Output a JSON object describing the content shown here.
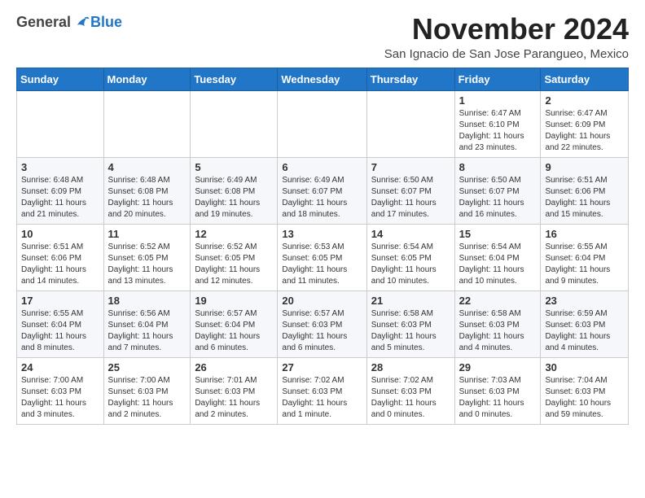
{
  "logo": {
    "general": "General",
    "blue": "Blue"
  },
  "header": {
    "month_title": "November 2024",
    "subtitle": "San Ignacio de San Jose Parangueo, Mexico"
  },
  "weekdays": [
    "Sunday",
    "Monday",
    "Tuesday",
    "Wednesday",
    "Thursday",
    "Friday",
    "Saturday"
  ],
  "weeks": [
    [
      {
        "day": "",
        "info": ""
      },
      {
        "day": "",
        "info": ""
      },
      {
        "day": "",
        "info": ""
      },
      {
        "day": "",
        "info": ""
      },
      {
        "day": "",
        "info": ""
      },
      {
        "day": "1",
        "info": "Sunrise: 6:47 AM\nSunset: 6:10 PM\nDaylight: 11 hours and 23 minutes."
      },
      {
        "day": "2",
        "info": "Sunrise: 6:47 AM\nSunset: 6:09 PM\nDaylight: 11 hours and 22 minutes."
      }
    ],
    [
      {
        "day": "3",
        "info": "Sunrise: 6:48 AM\nSunset: 6:09 PM\nDaylight: 11 hours and 21 minutes."
      },
      {
        "day": "4",
        "info": "Sunrise: 6:48 AM\nSunset: 6:08 PM\nDaylight: 11 hours and 20 minutes."
      },
      {
        "day": "5",
        "info": "Sunrise: 6:49 AM\nSunset: 6:08 PM\nDaylight: 11 hours and 19 minutes."
      },
      {
        "day": "6",
        "info": "Sunrise: 6:49 AM\nSunset: 6:07 PM\nDaylight: 11 hours and 18 minutes."
      },
      {
        "day": "7",
        "info": "Sunrise: 6:50 AM\nSunset: 6:07 PM\nDaylight: 11 hours and 17 minutes."
      },
      {
        "day": "8",
        "info": "Sunrise: 6:50 AM\nSunset: 6:07 PM\nDaylight: 11 hours and 16 minutes."
      },
      {
        "day": "9",
        "info": "Sunrise: 6:51 AM\nSunset: 6:06 PM\nDaylight: 11 hours and 15 minutes."
      }
    ],
    [
      {
        "day": "10",
        "info": "Sunrise: 6:51 AM\nSunset: 6:06 PM\nDaylight: 11 hours and 14 minutes."
      },
      {
        "day": "11",
        "info": "Sunrise: 6:52 AM\nSunset: 6:05 PM\nDaylight: 11 hours and 13 minutes."
      },
      {
        "day": "12",
        "info": "Sunrise: 6:52 AM\nSunset: 6:05 PM\nDaylight: 11 hours and 12 minutes."
      },
      {
        "day": "13",
        "info": "Sunrise: 6:53 AM\nSunset: 6:05 PM\nDaylight: 11 hours and 11 minutes."
      },
      {
        "day": "14",
        "info": "Sunrise: 6:54 AM\nSunset: 6:05 PM\nDaylight: 11 hours and 10 minutes."
      },
      {
        "day": "15",
        "info": "Sunrise: 6:54 AM\nSunset: 6:04 PM\nDaylight: 11 hours and 10 minutes."
      },
      {
        "day": "16",
        "info": "Sunrise: 6:55 AM\nSunset: 6:04 PM\nDaylight: 11 hours and 9 minutes."
      }
    ],
    [
      {
        "day": "17",
        "info": "Sunrise: 6:55 AM\nSunset: 6:04 PM\nDaylight: 11 hours and 8 minutes."
      },
      {
        "day": "18",
        "info": "Sunrise: 6:56 AM\nSunset: 6:04 PM\nDaylight: 11 hours and 7 minutes."
      },
      {
        "day": "19",
        "info": "Sunrise: 6:57 AM\nSunset: 6:04 PM\nDaylight: 11 hours and 6 minutes."
      },
      {
        "day": "20",
        "info": "Sunrise: 6:57 AM\nSunset: 6:03 PM\nDaylight: 11 hours and 6 minutes."
      },
      {
        "day": "21",
        "info": "Sunrise: 6:58 AM\nSunset: 6:03 PM\nDaylight: 11 hours and 5 minutes."
      },
      {
        "day": "22",
        "info": "Sunrise: 6:58 AM\nSunset: 6:03 PM\nDaylight: 11 hours and 4 minutes."
      },
      {
        "day": "23",
        "info": "Sunrise: 6:59 AM\nSunset: 6:03 PM\nDaylight: 11 hours and 4 minutes."
      }
    ],
    [
      {
        "day": "24",
        "info": "Sunrise: 7:00 AM\nSunset: 6:03 PM\nDaylight: 11 hours and 3 minutes."
      },
      {
        "day": "25",
        "info": "Sunrise: 7:00 AM\nSunset: 6:03 PM\nDaylight: 11 hours and 2 minutes."
      },
      {
        "day": "26",
        "info": "Sunrise: 7:01 AM\nSunset: 6:03 PM\nDaylight: 11 hours and 2 minutes."
      },
      {
        "day": "27",
        "info": "Sunrise: 7:02 AM\nSunset: 6:03 PM\nDaylight: 11 hours and 1 minute."
      },
      {
        "day": "28",
        "info": "Sunrise: 7:02 AM\nSunset: 6:03 PM\nDaylight: 11 hours and 0 minutes."
      },
      {
        "day": "29",
        "info": "Sunrise: 7:03 AM\nSunset: 6:03 PM\nDaylight: 11 hours and 0 minutes."
      },
      {
        "day": "30",
        "info": "Sunrise: 7:04 AM\nSunset: 6:03 PM\nDaylight: 10 hours and 59 minutes."
      }
    ]
  ]
}
